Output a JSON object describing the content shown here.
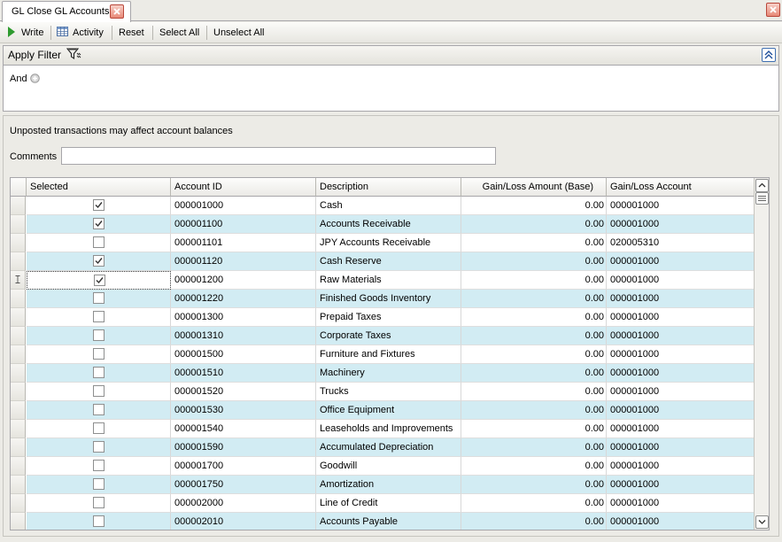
{
  "tab": {
    "title": "GL Close GL Accounts"
  },
  "toolbar": {
    "write": "Write",
    "activity": "Activity",
    "reset": "Reset",
    "select_all": "Select All",
    "unselect_all": "Unselect All"
  },
  "filter": {
    "title": "Apply Filter",
    "logic": "And"
  },
  "notice": "Unposted transactions may affect account balances",
  "comments": {
    "label": "Comments",
    "value": ""
  },
  "grid": {
    "columns": [
      "Selected",
      "Account ID",
      "Description",
      "Gain/Loss Amount (Base)",
      "Gain/Loss Account"
    ],
    "rows": [
      {
        "selected": true,
        "account_id": "000001000",
        "description": "Cash",
        "amount": "0.00",
        "gl_account": "000001000"
      },
      {
        "selected": true,
        "account_id": "000001100",
        "description": "Accounts Receivable",
        "amount": "0.00",
        "gl_account": "000001000"
      },
      {
        "selected": false,
        "account_id": "000001101",
        "description": "JPY Accounts Receivable",
        "amount": "0.00",
        "gl_account": "020005310"
      },
      {
        "selected": true,
        "account_id": "000001120",
        "description": "Cash Reserve",
        "amount": "0.00",
        "gl_account": "000001000"
      },
      {
        "selected": true,
        "account_id": "000001200",
        "description": "Raw Materials",
        "amount": "0.00",
        "gl_account": "000001000"
      },
      {
        "selected": false,
        "account_id": "000001220",
        "description": "Finished Goods Inventory",
        "amount": "0.00",
        "gl_account": "000001000"
      },
      {
        "selected": false,
        "account_id": "000001300",
        "description": "Prepaid Taxes",
        "amount": "0.00",
        "gl_account": "000001000"
      },
      {
        "selected": false,
        "account_id": "000001310",
        "description": "Corporate Taxes",
        "amount": "0.00",
        "gl_account": "000001000"
      },
      {
        "selected": false,
        "account_id": "000001500",
        "description": "Furniture and Fixtures",
        "amount": "0.00",
        "gl_account": "000001000"
      },
      {
        "selected": false,
        "account_id": "000001510",
        "description": "Machinery",
        "amount": "0.00",
        "gl_account": "000001000"
      },
      {
        "selected": false,
        "account_id": "000001520",
        "description": "Trucks",
        "amount": "0.00",
        "gl_account": "000001000"
      },
      {
        "selected": false,
        "account_id": "000001530",
        "description": "Office Equipment",
        "amount": "0.00",
        "gl_account": "000001000"
      },
      {
        "selected": false,
        "account_id": "000001540",
        "description": "Leaseholds and Improvements",
        "amount": "0.00",
        "gl_account": "000001000"
      },
      {
        "selected": false,
        "account_id": "000001590",
        "description": "Accumulated Depreciation",
        "amount": "0.00",
        "gl_account": "000001000"
      },
      {
        "selected": false,
        "account_id": "000001700",
        "description": "Goodwill",
        "amount": "0.00",
        "gl_account": "000001000"
      },
      {
        "selected": false,
        "account_id": "000001750",
        "description": "Amortization",
        "amount": "0.00",
        "gl_account": "000001000"
      },
      {
        "selected": false,
        "account_id": "000002000",
        "description": "Line of Credit",
        "amount": "0.00",
        "gl_account": "000001000"
      },
      {
        "selected": false,
        "account_id": "000002010",
        "description": "Accounts Payable",
        "amount": "0.00",
        "gl_account": "000001000"
      }
    ]
  },
  "colors": {
    "alt_row": "#d2ecf3",
    "accent": "#2e9a2e"
  }
}
